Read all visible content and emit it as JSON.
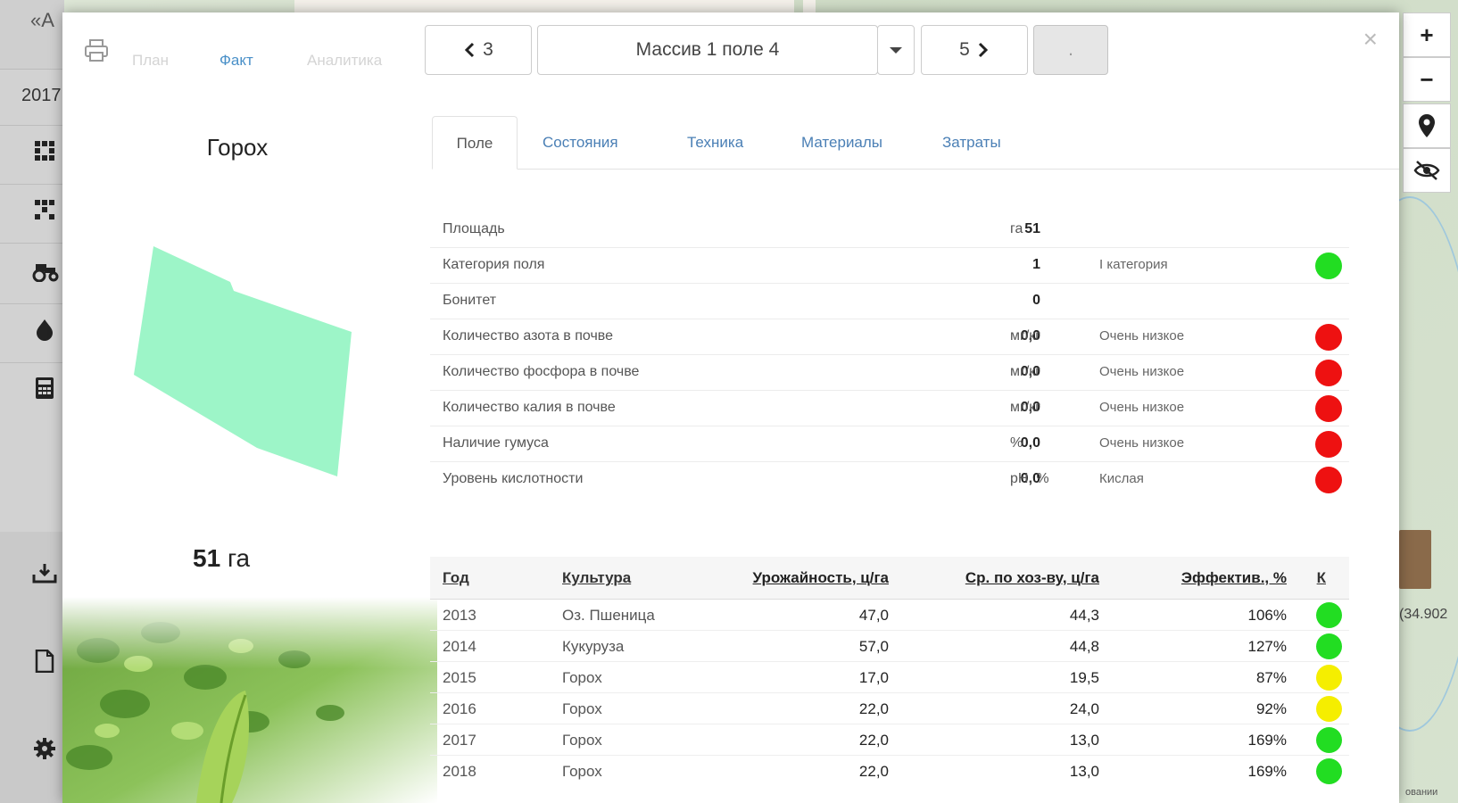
{
  "background": {
    "header_text": "«А",
    "year_label": "2017",
    "coord_text": "(34.902",
    "corner_note": "овании"
  },
  "map_controls": {
    "zoom_in": "+",
    "zoom_out": "−"
  },
  "modal": {
    "close": "×",
    "modes": [
      {
        "label": "План",
        "active": false
      },
      {
        "label": "Факт",
        "active": true
      },
      {
        "label": "Аналитика",
        "active": false
      }
    ],
    "nav": {
      "prev_label": "3",
      "field_select": "Массив 1 поле 4",
      "next_label": "5",
      "extra_button": "."
    },
    "crop_title": "Горох",
    "area": {
      "value": "51",
      "unit": "га"
    },
    "tabs": [
      "Поле",
      "Состояния",
      "Техника",
      "Материалы",
      "Затраты"
    ],
    "params": [
      {
        "name": "Площадь",
        "value": "51",
        "unit": "га",
        "desc": "",
        "color": ""
      },
      {
        "name": "Категория поля",
        "value": "1",
        "unit": "",
        "desc": "I категория",
        "color": "#22dd22"
      },
      {
        "name": "Бонитет",
        "value": "0",
        "unit": "",
        "desc": "",
        "color": ""
      },
      {
        "name": "Количество азота в почве",
        "value": "0,0",
        "unit": "мг/кг",
        "desc": "Очень низкое",
        "color": "#ee1111"
      },
      {
        "name": "Количество фосфора в почве",
        "value": "0,0",
        "unit": "мг/кг",
        "desc": "Очень низкое",
        "color": "#ee1111"
      },
      {
        "name": "Количество калия в почве",
        "value": "0,0",
        "unit": "мг/кг",
        "desc": "Очень низкое",
        "color": "#ee1111"
      },
      {
        "name": "Наличие гумуса",
        "value": "0,0",
        "unit": "%",
        "desc": "Очень низкое",
        "color": "#ee1111"
      },
      {
        "name": "Уровень кислотности",
        "value": "0,0",
        "unit": "pH, %",
        "desc": "Кислая",
        "color": "#ee1111"
      }
    ],
    "history": {
      "headers": {
        "year": "Год",
        "crop": "Культура",
        "yield": "Урожайность, ц/га",
        "avg": "Ср. по хоз-ву, ц/га",
        "eff": "Эффектив., %",
        "k": "К"
      },
      "rows": [
        {
          "year": "2013",
          "crop": "Оз. Пшеница",
          "yield": "47,0",
          "avg": "44,3",
          "eff": "106%",
          "color": "#22dd22"
        },
        {
          "year": "2014",
          "crop": "Кукуруза",
          "yield": "57,0",
          "avg": "44,8",
          "eff": "127%",
          "color": "#22dd22"
        },
        {
          "year": "2015",
          "crop": "Горох",
          "yield": "17,0",
          "avg": "19,5",
          "eff": "87%",
          "color": "#f5ee00"
        },
        {
          "year": "2016",
          "crop": "Горох",
          "yield": "22,0",
          "avg": "24,0",
          "eff": "92%",
          "color": "#f5ee00"
        },
        {
          "year": "2017",
          "crop": "Горох",
          "yield": "22,0",
          "avg": "13,0",
          "eff": "169%",
          "color": "#22dd22"
        },
        {
          "year": "2018",
          "crop": "Горох",
          "yield": "22,0",
          "avg": "13,0",
          "eff": "169%",
          "color": "#22dd22"
        }
      ]
    },
    "field_color": "#9df5c8"
  },
  "icons": {
    "print": "printer-icon",
    "prev": "chevron-left-icon",
    "next": "chevron-right-icon",
    "dropdown": "caret-down-icon",
    "pin": "map-pin-icon",
    "hide": "eye-off-icon"
  }
}
